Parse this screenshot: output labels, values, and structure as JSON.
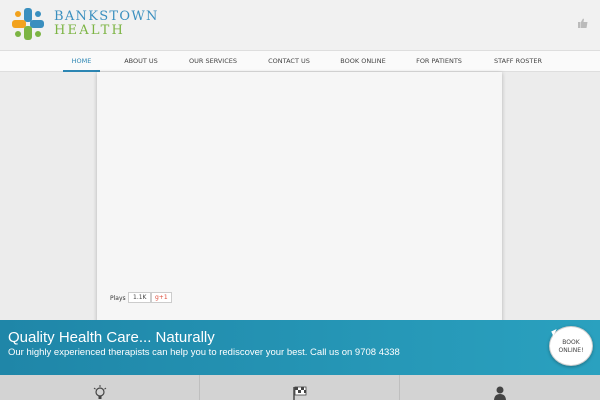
{
  "header": {
    "brand_line1": "BANKSTOWN",
    "brand_line2": "HEALTH",
    "logo_icon": "bankstown-health-logo",
    "like_icon": "thumbs-up-icon",
    "colors": {
      "brand_blue": "#3a8fbf",
      "brand_green": "#7cb443",
      "brand_orange": "#f2a21d"
    }
  },
  "nav": {
    "items": [
      {
        "label": "HOME",
        "active": true
      },
      {
        "label": "ABOUT US"
      },
      {
        "label": "OUR SERVICES"
      },
      {
        "label": "CONTACT US"
      },
      {
        "label": "BOOK ONLINE"
      },
      {
        "label": "FOR PATIENTS"
      },
      {
        "label": "STAFF ROSTER"
      }
    ],
    "accent": "#2c86b3"
  },
  "panel": {
    "plays_label": "Plays",
    "plays_count": "1.1K",
    "gplus_label": "g+1"
  },
  "banner": {
    "title": "Quality Health Care... Naturally",
    "text": "Our highly experienced therapists can help you to rediscover your best. Call us on 9708 4338",
    "book_line1": "BOOK",
    "book_line2": "ONLINE!",
    "color": "#2496b7"
  },
  "tiles": [
    {
      "icon": "lightbulb-icon"
    },
    {
      "icon": "checkered-flag-icon"
    },
    {
      "icon": "person-icon"
    }
  ]
}
